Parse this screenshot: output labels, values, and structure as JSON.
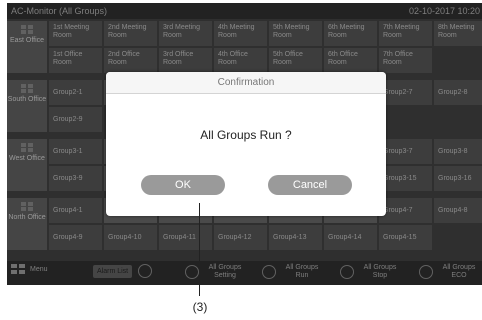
{
  "title": "AC-Monitor (All Groups)",
  "datetime": "02-10-2017  10:20",
  "offices": [
    {
      "label": "East Office",
      "cells": [
        [
          "1st Meeting Room",
          "2nd Meeting Room",
          "3rd Meeting Room",
          "4th Meeting Room",
          "5th Meeting Room",
          "6th Meeting Room",
          "7th Meeting Room",
          "8th Meeting Room"
        ],
        [
          "1st Office Room",
          "2nd Office Room",
          "3rd Office Room",
          "4th Office Room",
          "5th Office Room",
          "6th Office Room",
          "7th Office Room"
        ]
      ]
    },
    {
      "label": "South Office",
      "cells": [
        [
          "Group2-1",
          "",
          "",
          "",
          "",
          "",
          "Group2-7",
          "Group2-8"
        ],
        [
          "Group2-9"
        ]
      ]
    },
    {
      "label": "West Office",
      "cells": [
        [
          "Group3-1",
          "",
          "",
          "",
          "",
          "",
          "Group3-7",
          "Group3-8"
        ],
        [
          "Group3-9",
          "",
          "",
          "",
          "",
          "",
          "Group3-15",
          "Group3-16"
        ]
      ]
    },
    {
      "label": "North Office",
      "cells": [
        [
          "Group4-1",
          "",
          "",
          "",
          "",
          "",
          "Group4-7",
          "Group4-8"
        ],
        [
          "Group4-9",
          "Group4-10",
          "Group4-11",
          "Group4-12",
          "Group4-13",
          "Group4-14",
          "Group4-15"
        ]
      ]
    }
  ],
  "bottom": {
    "menu": "Menu",
    "alarm_list": "Alarm List",
    "setting": "All Groups Setting",
    "run": "All Groups Run",
    "stop": "All Groups Stop",
    "eco": "All Groups ECO"
  },
  "dialog": {
    "title": "Confirmation",
    "message": "All Groups Run ?",
    "ok": "OK",
    "cancel": "Cancel"
  },
  "callout": "(3)"
}
